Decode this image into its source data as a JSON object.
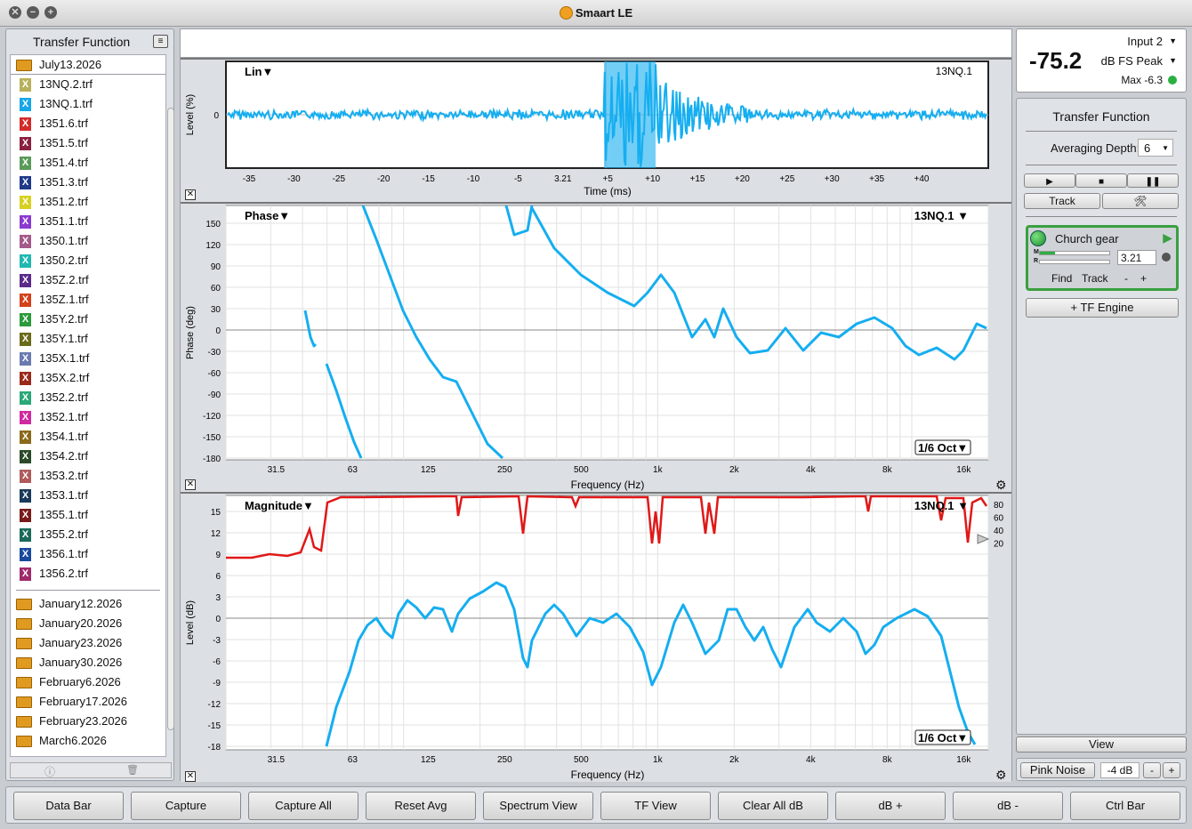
{
  "window": {
    "title": "Smaart LE",
    "close": "✕",
    "min": "−",
    "max": "+"
  },
  "left": {
    "header": "Transfer Function",
    "open_folder": "July13.2026",
    "files": [
      {
        "name": "13NQ.2.trf",
        "color": "#b8b05a"
      },
      {
        "name": "13NQ.1.trf",
        "color": "#17a7e8"
      },
      {
        "name": "1351.6.trf",
        "color": "#d42a2a"
      },
      {
        "name": "1351.5.trf",
        "color": "#8a2040"
      },
      {
        "name": "1351.4.trf",
        "color": "#5a9a58"
      },
      {
        "name": "1351.3.trf",
        "color": "#1f3a8a"
      },
      {
        "name": "1351.2.trf",
        "color": "#d8d020"
      },
      {
        "name": "1351.1.trf",
        "color": "#8a3ad0"
      },
      {
        "name": "1350.1.trf",
        "color": "#a45a8a"
      },
      {
        "name": "1350.2.trf",
        "color": "#20b8b0"
      },
      {
        "name": "135Z.2.trf",
        "color": "#5a2a8a"
      },
      {
        "name": "135Z.1.trf",
        "color": "#d4401a"
      },
      {
        "name": "135Y.2.trf",
        "color": "#2a9a3a"
      },
      {
        "name": "135Y.1.trf",
        "color": "#6a6a1a"
      },
      {
        "name": "135X.1.trf",
        "color": "#6a7ab0"
      },
      {
        "name": "135X.2.trf",
        "color": "#9a2a1a"
      },
      {
        "name": "1352.2.trf",
        "color": "#2aa878"
      },
      {
        "name": "1352.1.trf",
        "color": "#d02aa0"
      },
      {
        "name": "1354.1.trf",
        "color": "#8a6a1a"
      },
      {
        "name": "1354.2.trf",
        "color": "#2a4a2a"
      },
      {
        "name": "1353.2.trf",
        "color": "#b05a5a"
      },
      {
        "name": "1353.1.trf",
        "color": "#1a3a5a"
      },
      {
        "name": "1355.1.trf",
        "color": "#7a1a1a"
      },
      {
        "name": "1355.2.trf",
        "color": "#1a6a5a"
      },
      {
        "name": "1356.1.trf",
        "color": "#1a4aa0"
      },
      {
        "name": "1356.2.trf",
        "color": "#a02a6a"
      }
    ],
    "folders": [
      "January12.2026",
      "January20.2026",
      "January23.2026",
      "January30.2026",
      "February6.2026",
      "February17.2026",
      "February23.2026",
      "March6.2026"
    ],
    "foot_info": "ⓘ",
    "foot_trash": "🗑"
  },
  "impulse": {
    "mode": "Lin▼",
    "trace": "13NQ.1",
    "ylabel": "Level (%)",
    "yzero": "0",
    "xlabel": "Time (ms)",
    "ticks": [
      "-35",
      "-30",
      "-25",
      "-20",
      "-15",
      "-10",
      "-5",
      "3.21",
      "+5",
      "+10",
      "+15",
      "+20",
      "+25",
      "+30",
      "+35",
      "+40"
    ]
  },
  "phase": {
    "mode": "Phase▼",
    "trace": "13NQ.1 ▼",
    "ylabel": "Phase (deg)",
    "xlabel": "Frequency (Hz)",
    "smoothing": "1/6 Oct▼",
    "yticks": [
      "150",
      "120",
      "90",
      "60",
      "30",
      "0",
      "-30",
      "-60",
      "-90",
      "-120",
      "-150",
      "-180"
    ],
    "xticks": [
      "31.5",
      "63",
      "125",
      "250",
      "500",
      "1k",
      "2k",
      "4k",
      "8k",
      "16k"
    ]
  },
  "magnitude": {
    "mode": "Magnitude▼",
    "trace": "13NQ.1 ▼",
    "ylabel": "Level (dB)",
    "xlabel": "Frequency (Hz)",
    "smoothing": "1/6 Oct▼",
    "yticks": [
      "15",
      "12",
      "9",
      "6",
      "3",
      "0",
      "-3",
      "-6",
      "-9",
      "-12",
      "-15",
      "-18"
    ],
    "xticks": [
      "31.5",
      "63",
      "125",
      "250",
      "500",
      "1k",
      "2k",
      "4k",
      "8k",
      "16k"
    ],
    "coh_ticks": [
      "80",
      "60",
      "40",
      "20"
    ]
  },
  "meter": {
    "input": "Input 2",
    "value": "-75.2",
    "unit": "dB FS Peak",
    "max": "Max -6.3"
  },
  "tf": {
    "title": "Transfer Function",
    "avg_label": "Averaging Depth:",
    "avg_value": "6",
    "track": "Track",
    "engine_name": "Church gear",
    "engine_value": "3.21",
    "find": "Find",
    "track2": "Track",
    "minus": "-",
    "plus": "+",
    "add_engine": "+ TF Engine",
    "view": "View",
    "pink": "Pink Noise",
    "pink_level": "-4 dB",
    "pm_minus": "-",
    "pm_plus": "+",
    "m_label": "M",
    "r_label": "R"
  },
  "bottom": [
    "Data Bar",
    "Capture",
    "Capture All",
    "Reset Avg",
    "Spectrum View",
    "TF View",
    "Clear All dB",
    "dB +",
    "dB -",
    "Ctrl Bar"
  ]
}
